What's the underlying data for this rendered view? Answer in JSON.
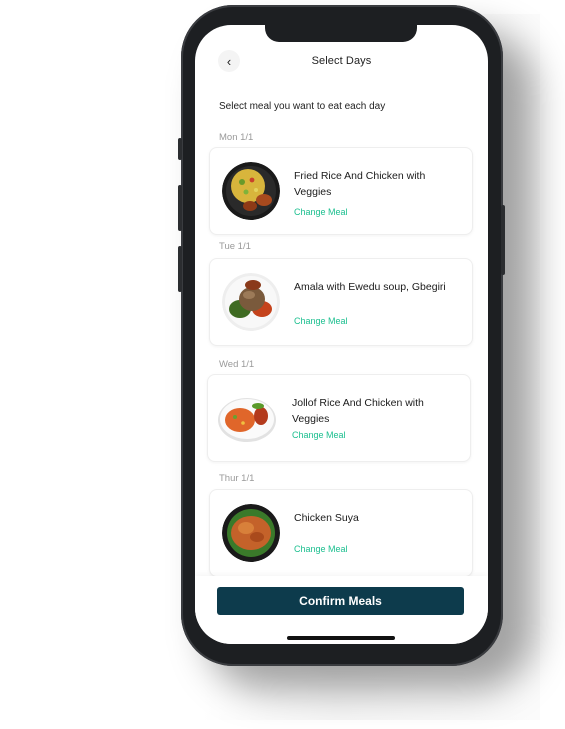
{
  "header": {
    "back_icon": "chevron-left-icon",
    "back_glyph": "‹",
    "title": "Select Days"
  },
  "subtitle": "Select meal you want to eat each day",
  "days": [
    {
      "label": "Mon 1/1",
      "meal": "Fried Rice And Chicken with Veggies",
      "action": "Change Meal"
    },
    {
      "label": "Tue 1/1",
      "meal": "Amala with Ewedu soup, Gbegiri",
      "action": "Change Meal"
    },
    {
      "label": "Wed 1/1",
      "meal": "Jollof Rice And Chicken with Veggies",
      "action": "Change Meal"
    },
    {
      "label": "Thur 1/1",
      "meal": "Chicken Suya",
      "action": "Change Meal"
    }
  ],
  "confirm_label": "Confirm Meals",
  "colors": {
    "accent": "#1bbf8f",
    "primary_button": "#0d3b4c",
    "phone_frame": "#1d1f22"
  }
}
